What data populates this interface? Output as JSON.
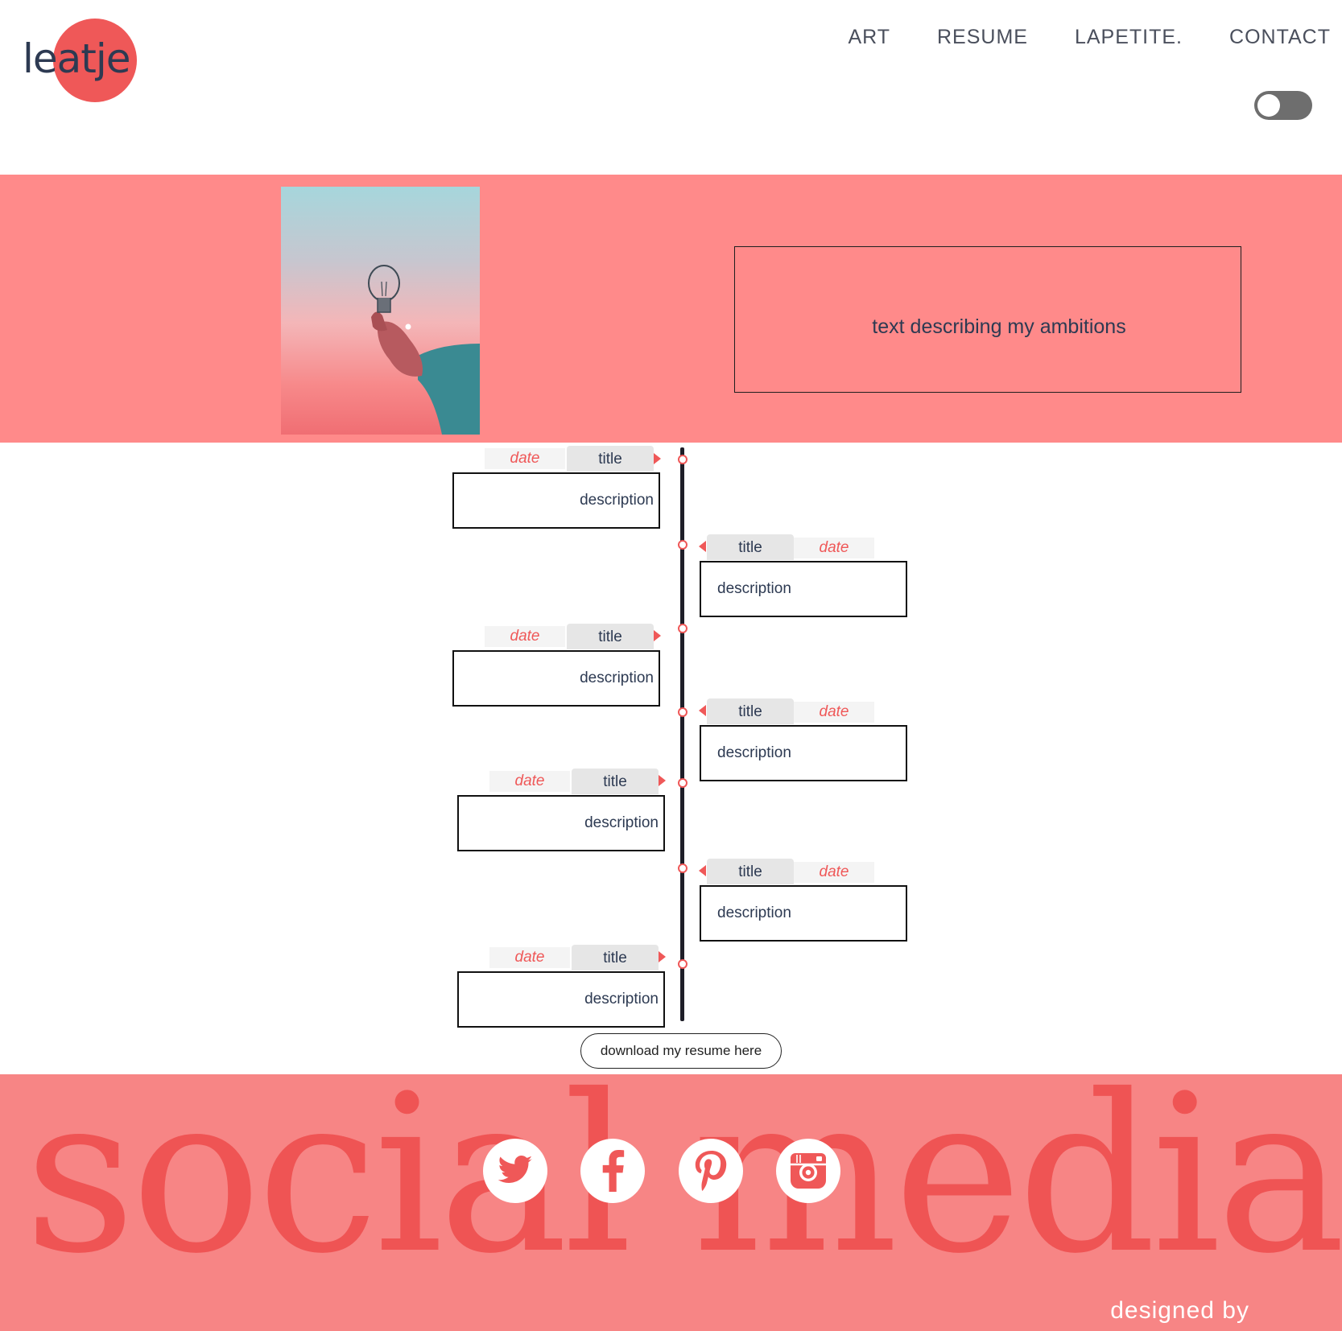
{
  "header": {
    "logo_text": "leatje",
    "nav": [
      "ART",
      "RESUME",
      "LAPETITE.",
      "CONTACT"
    ],
    "theme_toggle": "off"
  },
  "hero": {
    "ambition_text": "text describing my ambitions"
  },
  "timeline": [
    {
      "side": "left",
      "date": "date",
      "title": "title",
      "description": "description"
    },
    {
      "side": "right",
      "date": "date",
      "title": "title",
      "description": "description"
    },
    {
      "side": "left",
      "date": "date",
      "title": "title",
      "description": "description"
    },
    {
      "side": "right",
      "date": "date",
      "title": "title",
      "description": "description"
    },
    {
      "side": "left",
      "date": "date",
      "title": "title",
      "description": "description"
    },
    {
      "side": "right",
      "date": "date",
      "title": "title",
      "description": "description"
    },
    {
      "side": "left",
      "date": "date",
      "title": "title",
      "description": "description"
    }
  ],
  "download_button": "download my resume here",
  "footer": {
    "big_text": "social media",
    "social_icons": [
      "twitter-icon",
      "facebook-icon",
      "pinterest-icon",
      "instagram-icon"
    ],
    "designed_by": "designed by"
  },
  "colors": {
    "accent": "#ef5858",
    "hero_bg": "#ff8a8a",
    "footer_bg": "#f78585",
    "text_dark": "#2d3a52"
  }
}
